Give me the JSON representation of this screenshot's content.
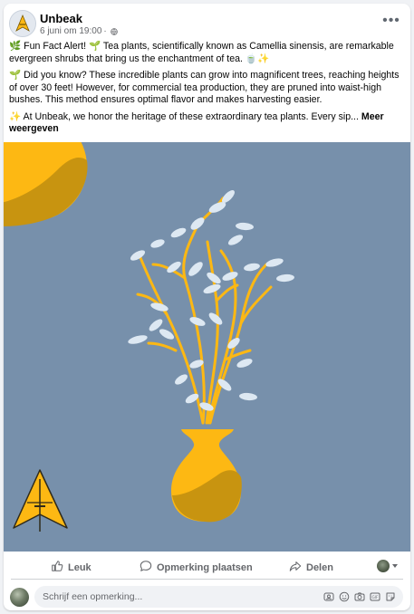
{
  "post": {
    "page_name": "Unbeak",
    "date": "6 juni om 19:00",
    "separator": "·",
    "paragraphs": [
      "🌿 Fun Fact Alert! 🌱 Tea plants, scientifically known as Camellia sinensis, are remarkable evergreen shrubs that bring us the enchantment of tea. 🍵✨",
      "🌱 Did you know? These incredible plants can grow into magnificent trees, reaching heights of over 30 feet! However, for commercial tea production, they are pruned into waist-high bushes. This method ensures optimal flavor and makes harvesting easier.",
      "✨ At Unbeak, we honor the heritage of these extraordinary tea plants. Every sip..."
    ],
    "see_more": "Meer weergeven"
  },
  "actions": {
    "like": "Leuk",
    "comment": "Opmerking plaatsen",
    "share": "Delen"
  },
  "comment_box": {
    "placeholder": "Schrijf een opmerking..."
  },
  "icons": {
    "more": "more-horizontal-icon",
    "globe": "globe-icon",
    "like": "thumbs-up-icon",
    "comment": "speech-bubble-icon",
    "share": "share-arrow-icon"
  },
  "colors": {
    "image_background": "#7790ab",
    "accent_yellow": "#fdb813",
    "accent_dark_yellow": "#c89410",
    "leaf": "#dde8f2",
    "text_secondary": "#65676b"
  }
}
